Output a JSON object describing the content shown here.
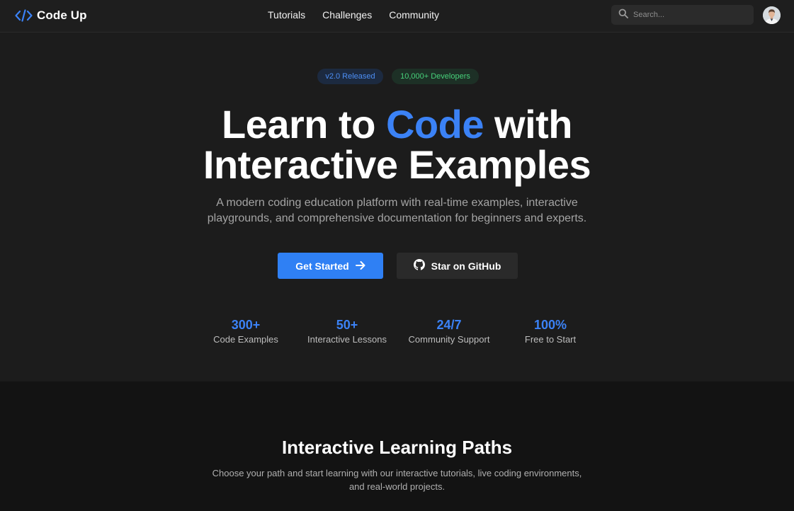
{
  "nav": {
    "brand": "Code Up",
    "links": [
      "Tutorials",
      "Challenges",
      "Community"
    ],
    "search_placeholder": "Search..."
  },
  "hero": {
    "badges": [
      "v2.0 Released",
      "10,000+ Developers"
    ],
    "headline_line1_pre": "Learn to ",
    "headline_line1_accent": "Code",
    "headline_line1_post": " with",
    "headline_line2": "Interactive Examples",
    "subtitle_line1": "A modern coding education platform with real-time examples, interactive",
    "subtitle_line2": "playgrounds, and comprehensive documentation for beginners and experts.",
    "primary_cta": "Get Started",
    "secondary_cta": "Star on GitHub",
    "stats": [
      {
        "value": "300+",
        "label": "Code Examples"
      },
      {
        "value": "50+",
        "label": "Interactive Lessons"
      },
      {
        "value": "24/7",
        "label": "Community Support"
      },
      {
        "value": "100%",
        "label": "Free to Start"
      }
    ]
  },
  "paths": {
    "title": "Interactive Learning Paths",
    "description_line1": "Choose your path and start learning with our interactive tutorials, live coding environments,",
    "description_line2": "and real-world projects."
  },
  "colors": {
    "accent": "#3b82f6",
    "background": "#1c1c1c",
    "section_background": "#131313",
    "badge_green": "#47d17a"
  },
  "icons": [
    "code-brackets-icon",
    "search-icon",
    "arrow-right-icon",
    "github-icon"
  ]
}
